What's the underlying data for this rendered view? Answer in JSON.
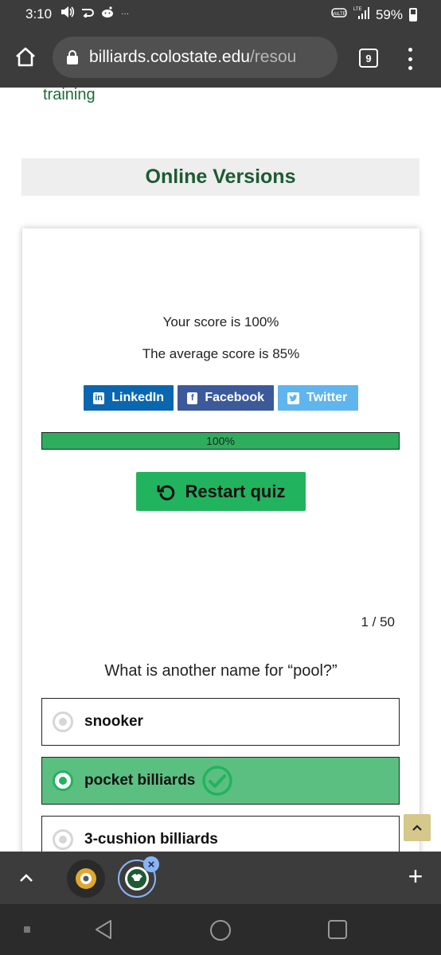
{
  "status_bar": {
    "time": "3:10",
    "battery": "59%",
    "network": "LTE"
  },
  "browser": {
    "url_domain": "billiards.colostate.edu",
    "url_path": "/resou",
    "tab_count": "9"
  },
  "page": {
    "link_text": "training",
    "section_title": "Online Versions"
  },
  "quiz": {
    "score_text": "Your score is 100%",
    "average_text": "The average score is 85%",
    "share": {
      "linkedin": "LinkedIn",
      "facebook": "Facebook",
      "twitter": "Twitter"
    },
    "progress_label": "100%",
    "progress_value": 1.0,
    "restart_label": "Restart quiz",
    "counter": "1 / 50",
    "question": "What is another name for “pool?”",
    "answers": [
      {
        "label": "snooker",
        "state": "unselected"
      },
      {
        "label": "pocket billiards",
        "state": "correct"
      },
      {
        "label": "3-cushion billiards",
        "state": "unselected"
      }
    ]
  },
  "colors": {
    "dark_green": "#1e5a32",
    "quiz_green": "#22b35e",
    "correct_bg": "#5cbf82",
    "linkedin": "#0b66b0",
    "facebook": "#3c5a9a",
    "twitter": "#60b5ee",
    "scroll_btn": "#d5c88a",
    "chrome_bar": "#3c3c3c"
  },
  "icons": {
    "home": "home-icon",
    "lock": "lock-icon",
    "menu": "more-vert-icon",
    "restart": "undo-icon",
    "check": "check-circle-icon",
    "scroll_top": "chevron-up-icon",
    "new_tab": "plus-icon",
    "nav_back": "triangle-back-icon",
    "nav_home": "circle-home-icon",
    "nav_recents": "square-recents-icon"
  }
}
